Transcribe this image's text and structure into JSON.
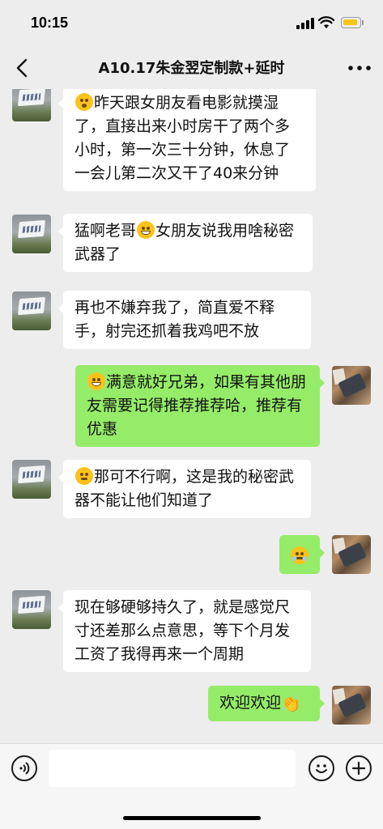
{
  "status_bar": {
    "time": "10:15"
  },
  "nav": {
    "title": "A10.17朱金翌定制款+延时",
    "back_icon": "chevron-left-icon",
    "more_icon": "more-dots-icon"
  },
  "messages": [
    {
      "side": "left",
      "emoji_icon": "sleepy-face-icon",
      "text": "昨天跟女朋友看电影就摸湿了，直接出来小时房干了两个多小时，第一次三十分钟，休息了一会儿第二次又干了40来分钟"
    },
    {
      "side": "left",
      "text_before": "猛啊老哥",
      "emoji_icon": "grinning-face-icon",
      "text_after": "女朋友说我用啥秘密武器了"
    },
    {
      "side": "left",
      "text": "再也不嫌弃我了，简直爱不释手，射完还抓着我鸡吧不放"
    },
    {
      "side": "right",
      "emoji_icon": "grinning-face-icon",
      "text": "满意就好兄弟，如果有其他朋友需要记得推荐推荐哈，推荐有优惠"
    },
    {
      "side": "left",
      "emoji_icon": "shushing-face-icon",
      "text": "那可不行啊，这是我的秘密武器不能让他们知道了"
    },
    {
      "side": "right",
      "emoji_icon": "pleading-face-icon",
      "text": ""
    },
    {
      "side": "left",
      "text": "现在够硬够持久了，就是感觉尺寸还差那么点意思，等下个月发工资了我得再来一个周期"
    },
    {
      "side": "right",
      "text": "欢迎欢迎",
      "emoji_icon": "clapping-hands-icon",
      "emoji_glyph": "👏"
    }
  ],
  "input_bar": {
    "value": "",
    "voice_icon": "voice-icon",
    "emoji_icon": "smiley-icon",
    "plus_icon": "plus-icon"
  },
  "colors": {
    "background": "#ededed",
    "bubble_left": "#ffffff",
    "bubble_right": "#95ec69",
    "battery": "#f5c518"
  }
}
